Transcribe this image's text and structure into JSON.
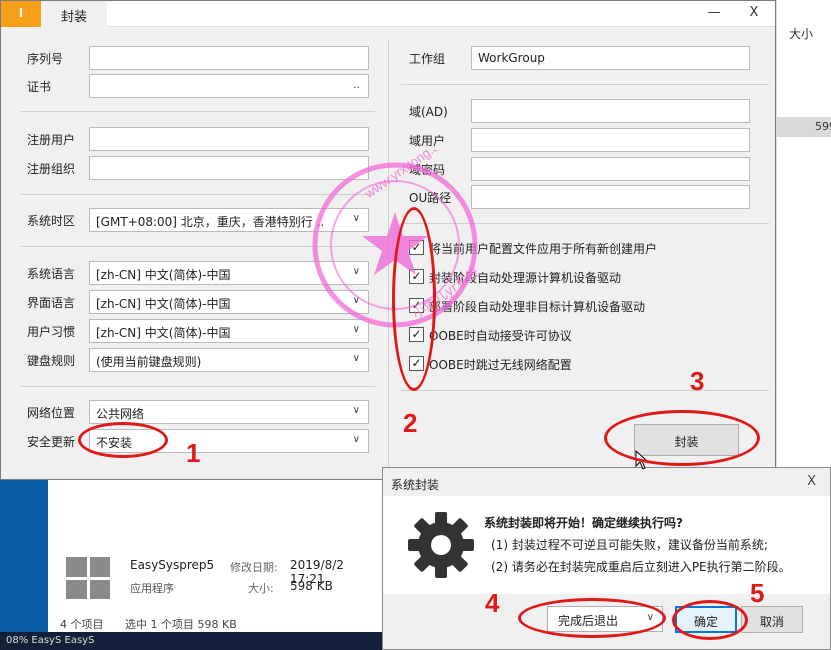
{
  "main": {
    "badge": "I",
    "tab_title": "封装",
    "minimize": "—",
    "close": "X",
    "left": {
      "serial_label": "序列号",
      "serial_value": "",
      "cert_label": "证书",
      "cert_value": "",
      "cert_browse": "..",
      "reg_user_label": "注册用户",
      "reg_user_value": "",
      "reg_org_label": "注册组织",
      "reg_org_value": "",
      "timezone_label": "系统时区",
      "timezone_value": "[GMT+08:00] 北京，重庆，香港特别行 ..",
      "sys_lang_label": "系统语言",
      "sys_lang_value": "[zh-CN] 中文(简体)-中国",
      "ui_lang_label": "界面语言",
      "ui_lang_value": "[zh-CN] 中文(简体)-中国",
      "user_locale_label": "用户习惯",
      "user_locale_value": "[zh-CN] 中文(简体)-中国",
      "keyboard_label": "键盘规则",
      "keyboard_value": "(使用当前键盘规则)",
      "network_label": "网络位置",
      "network_value": "公共网络",
      "security_label": "安全更新",
      "security_value": "不安装"
    },
    "right": {
      "workgroup_label": "工作组",
      "workgroup_value": "WorkGroup",
      "domain_label": "域(AD)",
      "domain_value": "",
      "domain_user_label": "域用户",
      "domain_user_value": "",
      "domain_pwd_label": "域密码",
      "domain_pwd_value": "",
      "ou_label": "OU路径",
      "ou_value": "",
      "checks": [
        {
          "label": "将当前用户配置文件应用于所有新创建用户",
          "mark": "✓"
        },
        {
          "label": "封装阶段自动处理源计算机设备驱动",
          "mark": "✓"
        },
        {
          "label": "部署阶段自动处理非目标计算机设备驱动",
          "mark": "✓"
        },
        {
          "label": "OOBE时自动接受许可协议",
          "mark": "✓"
        },
        {
          "label": "OOBE时跳过无线网络配置",
          "mark": "✓"
        }
      ],
      "seal_button": "封装"
    }
  },
  "dialog": {
    "title": "系统封装",
    "close": "X",
    "heading": "系统封装即将开始！确定继续执行吗?",
    "line1": "(1) 封装过程不可逆且可能失败，建议备份当前系统;",
    "line2": "(2) 请务必在封装完成重启后立刻进入PE执行第二阶段。",
    "after_select": "完成后退出",
    "ok": "确定",
    "cancel": "取消"
  },
  "explorer": {
    "column_size": "大小",
    "partial_size": "599",
    "file_name": "EasySysprep5",
    "file_type": "应用程序",
    "date_label": "修改日期:",
    "date_value": "2019/8/2 17:21",
    "size_label": "大小:",
    "size_value": "598 KB",
    "status_items": "4 个项目",
    "status_selected": "选中 1 个项目  598 KB",
    "taskbar_text": "08% EasyS          EasyS"
  },
  "annotations": [
    "1",
    "2",
    "3",
    "4",
    "5"
  ],
  "watermark": {
    "text_top": "www.yrxitong.com",
    "text_bottom": "小鱼儿yr系统"
  },
  "colors": {
    "annotation": "#e01818",
    "watermark": "#f06ad8",
    "badge": "#f6a01a",
    "focus": "#0078d7"
  }
}
